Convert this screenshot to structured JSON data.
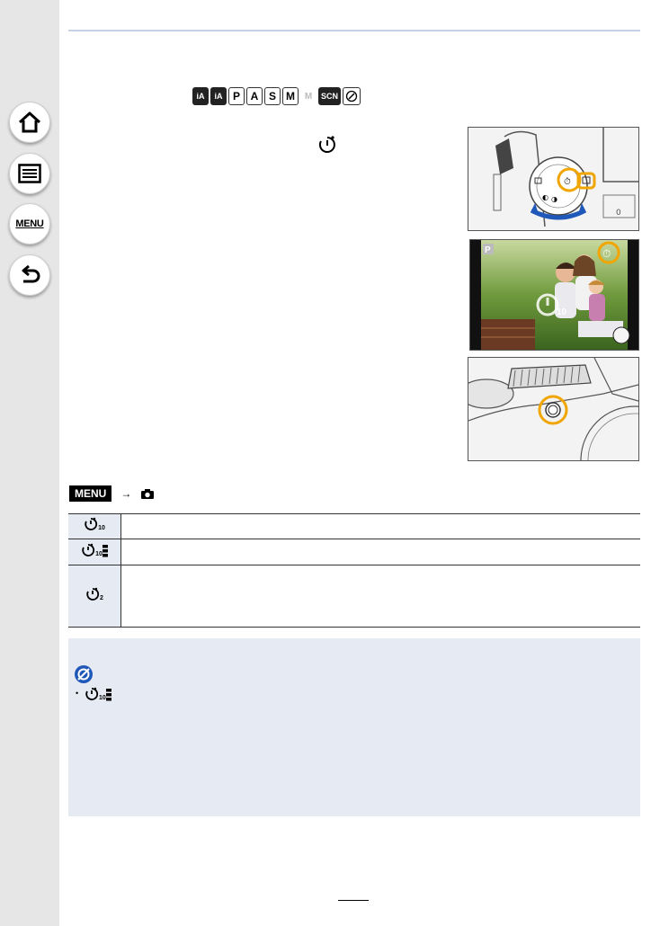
{
  "navigation": {
    "home_icon": "home-icon",
    "contents_icon": "list-icon",
    "menu_label": "MENU",
    "back_icon": "back-arrow-icon"
  },
  "modes": {
    "items": [
      "iA",
      "iA",
      "P",
      "A",
      "S",
      "M",
      "M",
      "SCN",
      "brush"
    ],
    "ia_label": "iA",
    "ia_plus_label": "iA",
    "p": "P",
    "a": "A",
    "s": "S",
    "m": "M",
    "movie_m": "M",
    "scn": "SCN"
  },
  "illustration": {
    "mode_badge": "P",
    "timer_value": "10"
  },
  "menu_path": {
    "menu_label": "MENU",
    "camera_icon": "camera-icon"
  },
  "options": [
    {
      "icon": "self-timer-10-icon",
      "digits": "10"
    },
    {
      "icon": "self-timer-10-burst-icon",
      "digits": "10"
    },
    {
      "icon": "self-timer-2-icon",
      "digits": "2"
    }
  ],
  "note": {
    "icon": "not-available-icon",
    "bullet_icon": "self-timer-10-burst-icon",
    "bullet_digits": "10"
  },
  "colors": {
    "highlight": "#f0a500",
    "accent_blue": "#1f58b8",
    "note_bg": "#e6eaf3",
    "rule": "#c8d2e6"
  }
}
